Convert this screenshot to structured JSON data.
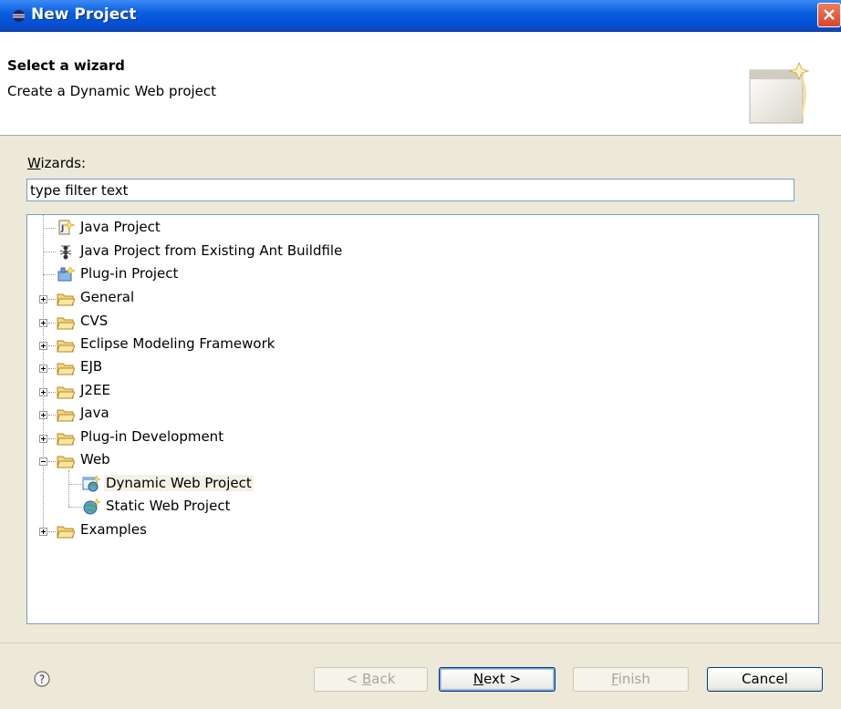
{
  "window": {
    "title": "New Project"
  },
  "header": {
    "title": "Select a wizard",
    "description": "Create a Dynamic Web project"
  },
  "wizards": {
    "label_accel": "W",
    "label_rest": "izards:",
    "filter_value": "type filter text"
  },
  "tree": {
    "items": [
      {
        "label": "Java Project",
        "icon": "java-project-icon",
        "level": 0,
        "expander": "none"
      },
      {
        "label": "Java Project from Existing Ant Buildfile",
        "icon": "ant-icon",
        "level": 0,
        "expander": "none"
      },
      {
        "label": "Plug-in Project",
        "icon": "plugin-project-icon",
        "level": 0,
        "expander": "none"
      },
      {
        "label": "General",
        "icon": "folder-icon",
        "level": 0,
        "expander": "plus"
      },
      {
        "label": "CVS",
        "icon": "folder-icon",
        "level": 0,
        "expander": "plus"
      },
      {
        "label": "Eclipse Modeling Framework",
        "icon": "folder-icon",
        "level": 0,
        "expander": "plus"
      },
      {
        "label": "EJB",
        "icon": "folder-icon",
        "level": 0,
        "expander": "plus"
      },
      {
        "label": "J2EE",
        "icon": "folder-icon",
        "level": 0,
        "expander": "plus"
      },
      {
        "label": "Java",
        "icon": "folder-icon",
        "level": 0,
        "expander": "plus"
      },
      {
        "label": "Plug-in Development",
        "icon": "folder-icon",
        "level": 0,
        "expander": "plus"
      },
      {
        "label": "Web",
        "icon": "folder-open-icon",
        "level": 0,
        "expander": "minus"
      },
      {
        "label": "Dynamic Web Project",
        "icon": "dynamic-web-project-icon",
        "level": 1,
        "expander": "none",
        "selected": true
      },
      {
        "label": "Static Web Project",
        "icon": "static-web-project-icon",
        "level": 1,
        "expander": "none"
      },
      {
        "label": "Examples",
        "icon": "folder-icon",
        "level": 0,
        "expander": "plus"
      }
    ]
  },
  "buttons": {
    "back": {
      "pre": "< ",
      "accel": "B",
      "rest": "ack"
    },
    "next": {
      "accel": "N",
      "rest": "ext >"
    },
    "finish": {
      "accel": "F",
      "rest": "inish"
    },
    "cancel": "Cancel"
  },
  "colors": {
    "title_bar": "#0550d6",
    "selection": "#f4f1e6",
    "dialog_bg": "#ece9d8"
  }
}
